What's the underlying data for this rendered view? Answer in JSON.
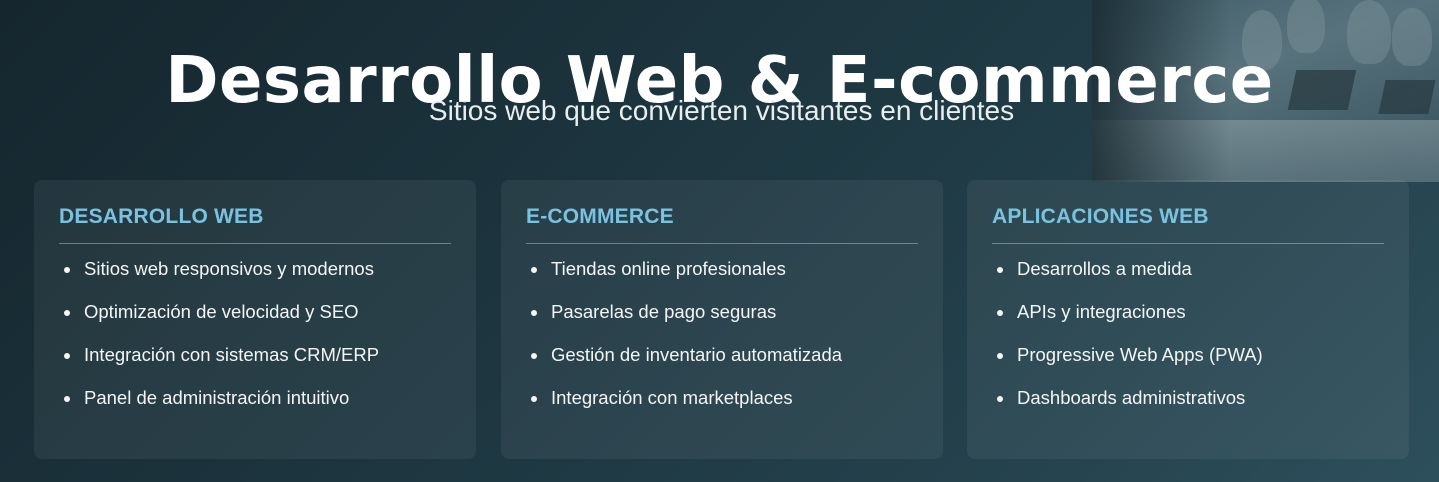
{
  "hero": {
    "title": "Desarrollo Web & E-commerce",
    "subtitle": "Sitios web que convierten visitantes en clientes"
  },
  "cards": [
    {
      "title": "DESARROLLO WEB",
      "items": [
        "Sitios web responsivos y modernos",
        "Optimización de velocidad y SEO",
        "Integración con sistemas CRM/ERP",
        "Panel de administración intuitivo"
      ]
    },
    {
      "title": "E-COMMERCE",
      "items": [
        "Tiendas online profesionales",
        "Pasarelas de pago seguras",
        "Gestión de inventario automatizada",
        "Integración con marketplaces"
      ]
    },
    {
      "title": "APLICACIONES WEB",
      "items": [
        "Desarrollos a medida",
        "APIs y integraciones",
        "Progressive Web Apps (PWA)",
        "Dashboards administrativos"
      ]
    }
  ],
  "colors": {
    "accent": "#79c3e0",
    "background": "#1d3640",
    "card_background": "rgba(255,255,255,0.06)",
    "text": "#f2f6f7"
  }
}
